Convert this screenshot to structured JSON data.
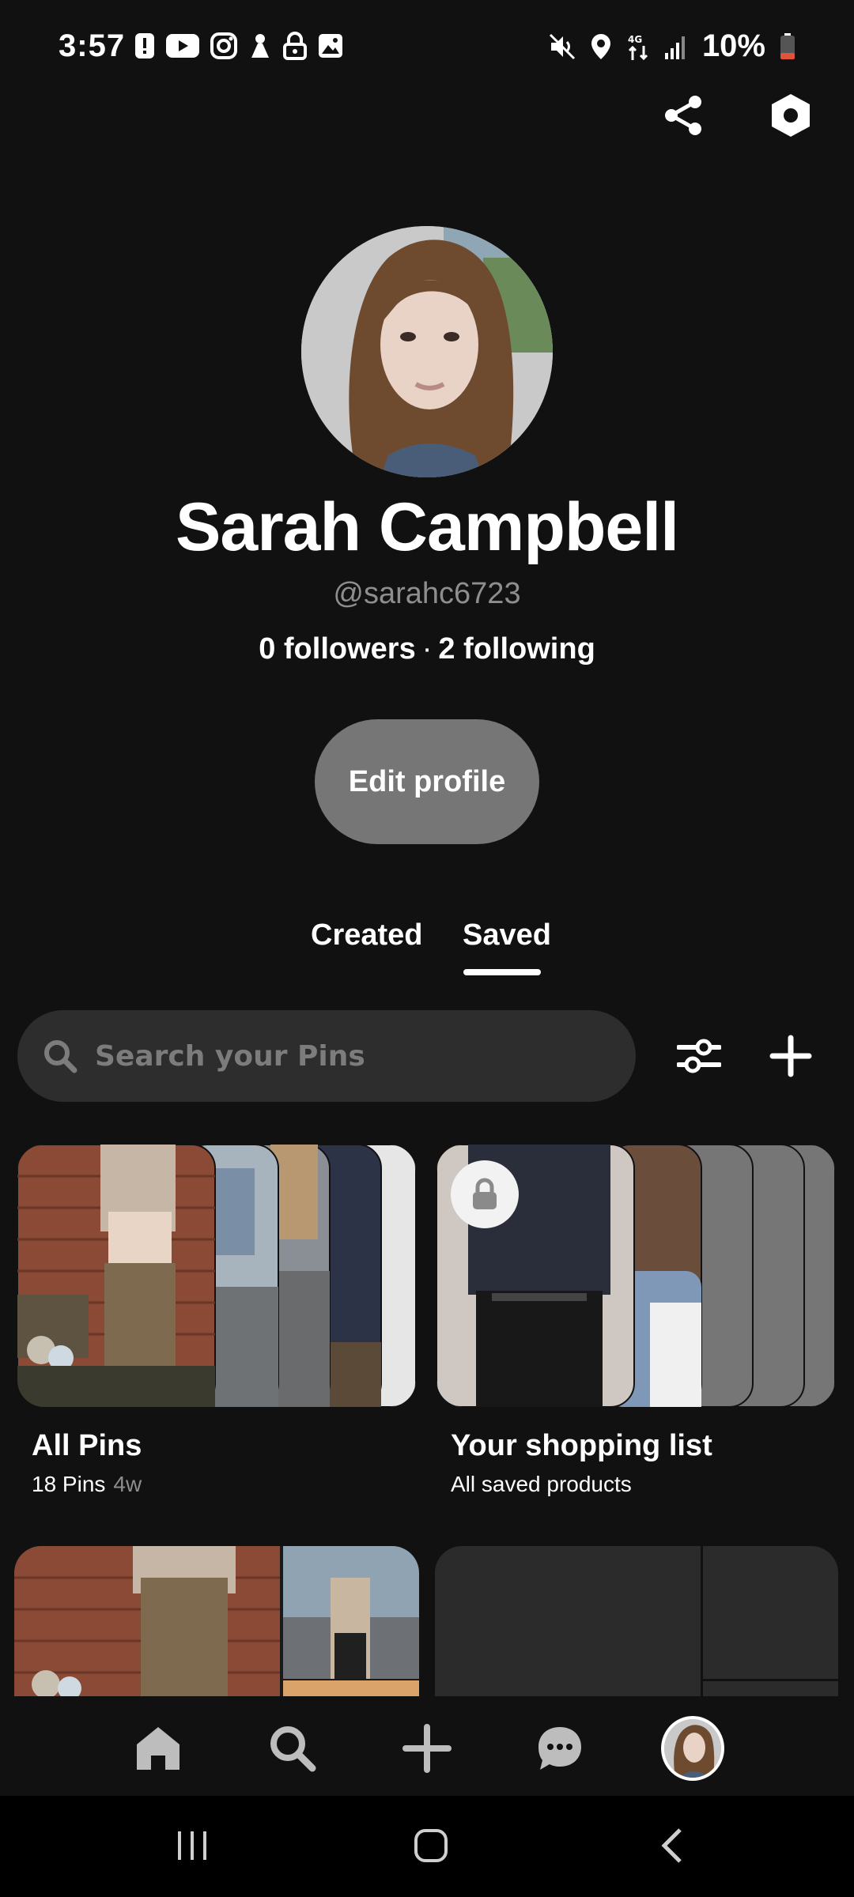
{
  "status_bar": {
    "time": "3:57",
    "battery": "10%",
    "left_icons": [
      "alert-icon",
      "youtube-icon",
      "instagram-icon",
      "notification-icon",
      "lock-icon",
      "image-icon"
    ],
    "right_icons": [
      "mute-icon",
      "location-icon",
      "data-icon",
      "signal-icon",
      "battery-icon"
    ]
  },
  "profile": {
    "name": "Sarah Campbell",
    "handle": "@sarahc6723",
    "followers": "0 followers",
    "separator": "·",
    "following": "2 following",
    "edit_label": "Edit profile"
  },
  "tabs": [
    {
      "label": "Created",
      "active": false
    },
    {
      "label": "Saved",
      "active": true
    }
  ],
  "search": {
    "placeholder": "Search your Pins"
  },
  "boards": [
    {
      "title": "All Pins",
      "count": "18 Pins",
      "age": "4w"
    },
    {
      "title": "Your shopping list",
      "subtitle": "All saved products",
      "locked": true
    }
  ],
  "bottom_nav": [
    "home-icon",
    "search-icon",
    "plus-icon",
    "messages-icon",
    "profile-avatar"
  ],
  "colors": {
    "background": "#111111",
    "button_gray": "#767676",
    "search_bg": "#2d2d2d",
    "muted_text": "#8e8e8e"
  }
}
